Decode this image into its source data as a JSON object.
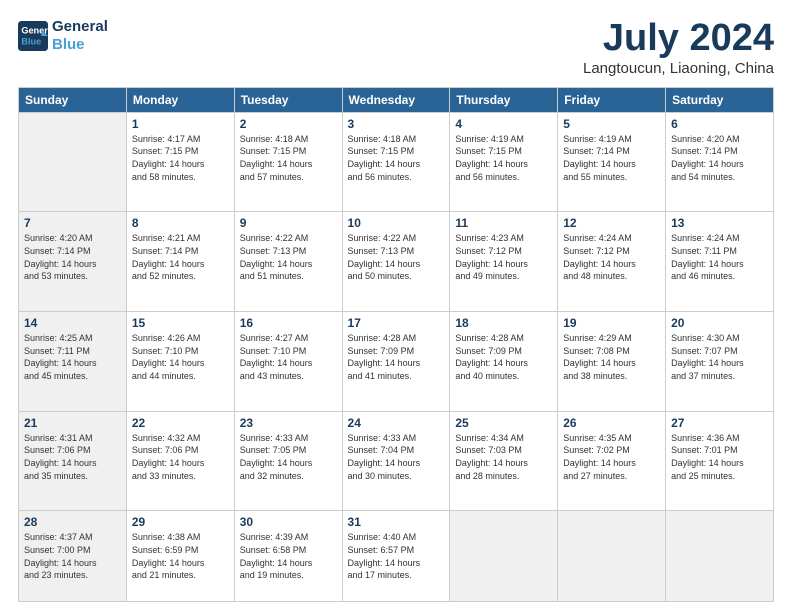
{
  "header": {
    "logo_line1": "General",
    "logo_line2": "Blue",
    "month_year": "July 2024",
    "location": "Langtoucun, Liaoning, China"
  },
  "weekdays": [
    "Sunday",
    "Monday",
    "Tuesday",
    "Wednesday",
    "Thursday",
    "Friday",
    "Saturday"
  ],
  "weeks": [
    [
      {
        "day": "",
        "shaded": true,
        "lines": []
      },
      {
        "day": "1",
        "shaded": false,
        "lines": [
          "Sunrise: 4:17 AM",
          "Sunset: 7:15 PM",
          "Daylight: 14 hours",
          "and 58 minutes."
        ]
      },
      {
        "day": "2",
        "shaded": false,
        "lines": [
          "Sunrise: 4:18 AM",
          "Sunset: 7:15 PM",
          "Daylight: 14 hours",
          "and 57 minutes."
        ]
      },
      {
        "day": "3",
        "shaded": false,
        "lines": [
          "Sunrise: 4:18 AM",
          "Sunset: 7:15 PM",
          "Daylight: 14 hours",
          "and 56 minutes."
        ]
      },
      {
        "day": "4",
        "shaded": false,
        "lines": [
          "Sunrise: 4:19 AM",
          "Sunset: 7:15 PM",
          "Daylight: 14 hours",
          "and 56 minutes."
        ]
      },
      {
        "day": "5",
        "shaded": false,
        "lines": [
          "Sunrise: 4:19 AM",
          "Sunset: 7:14 PM",
          "Daylight: 14 hours",
          "and 55 minutes."
        ]
      },
      {
        "day": "6",
        "shaded": false,
        "lines": [
          "Sunrise: 4:20 AM",
          "Sunset: 7:14 PM",
          "Daylight: 14 hours",
          "and 54 minutes."
        ]
      }
    ],
    [
      {
        "day": "7",
        "shaded": true,
        "lines": [
          "Sunrise: 4:20 AM",
          "Sunset: 7:14 PM",
          "Daylight: 14 hours",
          "and 53 minutes."
        ]
      },
      {
        "day": "8",
        "shaded": false,
        "lines": [
          "Sunrise: 4:21 AM",
          "Sunset: 7:14 PM",
          "Daylight: 14 hours",
          "and 52 minutes."
        ]
      },
      {
        "day": "9",
        "shaded": false,
        "lines": [
          "Sunrise: 4:22 AM",
          "Sunset: 7:13 PM",
          "Daylight: 14 hours",
          "and 51 minutes."
        ]
      },
      {
        "day": "10",
        "shaded": false,
        "lines": [
          "Sunrise: 4:22 AM",
          "Sunset: 7:13 PM",
          "Daylight: 14 hours",
          "and 50 minutes."
        ]
      },
      {
        "day": "11",
        "shaded": false,
        "lines": [
          "Sunrise: 4:23 AM",
          "Sunset: 7:12 PM",
          "Daylight: 14 hours",
          "and 49 minutes."
        ]
      },
      {
        "day": "12",
        "shaded": false,
        "lines": [
          "Sunrise: 4:24 AM",
          "Sunset: 7:12 PM",
          "Daylight: 14 hours",
          "and 48 minutes."
        ]
      },
      {
        "day": "13",
        "shaded": false,
        "lines": [
          "Sunrise: 4:24 AM",
          "Sunset: 7:11 PM",
          "Daylight: 14 hours",
          "and 46 minutes."
        ]
      }
    ],
    [
      {
        "day": "14",
        "shaded": true,
        "lines": [
          "Sunrise: 4:25 AM",
          "Sunset: 7:11 PM",
          "Daylight: 14 hours",
          "and 45 minutes."
        ]
      },
      {
        "day": "15",
        "shaded": false,
        "lines": [
          "Sunrise: 4:26 AM",
          "Sunset: 7:10 PM",
          "Daylight: 14 hours",
          "and 44 minutes."
        ]
      },
      {
        "day": "16",
        "shaded": false,
        "lines": [
          "Sunrise: 4:27 AM",
          "Sunset: 7:10 PM",
          "Daylight: 14 hours",
          "and 43 minutes."
        ]
      },
      {
        "day": "17",
        "shaded": false,
        "lines": [
          "Sunrise: 4:28 AM",
          "Sunset: 7:09 PM",
          "Daylight: 14 hours",
          "and 41 minutes."
        ]
      },
      {
        "day": "18",
        "shaded": false,
        "lines": [
          "Sunrise: 4:28 AM",
          "Sunset: 7:09 PM",
          "Daylight: 14 hours",
          "and 40 minutes."
        ]
      },
      {
        "day": "19",
        "shaded": false,
        "lines": [
          "Sunrise: 4:29 AM",
          "Sunset: 7:08 PM",
          "Daylight: 14 hours",
          "and 38 minutes."
        ]
      },
      {
        "day": "20",
        "shaded": false,
        "lines": [
          "Sunrise: 4:30 AM",
          "Sunset: 7:07 PM",
          "Daylight: 14 hours",
          "and 37 minutes."
        ]
      }
    ],
    [
      {
        "day": "21",
        "shaded": true,
        "lines": [
          "Sunrise: 4:31 AM",
          "Sunset: 7:06 PM",
          "Daylight: 14 hours",
          "and 35 minutes."
        ]
      },
      {
        "day": "22",
        "shaded": false,
        "lines": [
          "Sunrise: 4:32 AM",
          "Sunset: 7:06 PM",
          "Daylight: 14 hours",
          "and 33 minutes."
        ]
      },
      {
        "day": "23",
        "shaded": false,
        "lines": [
          "Sunrise: 4:33 AM",
          "Sunset: 7:05 PM",
          "Daylight: 14 hours",
          "and 32 minutes."
        ]
      },
      {
        "day": "24",
        "shaded": false,
        "lines": [
          "Sunrise: 4:33 AM",
          "Sunset: 7:04 PM",
          "Daylight: 14 hours",
          "and 30 minutes."
        ]
      },
      {
        "day": "25",
        "shaded": false,
        "lines": [
          "Sunrise: 4:34 AM",
          "Sunset: 7:03 PM",
          "Daylight: 14 hours",
          "and 28 minutes."
        ]
      },
      {
        "day": "26",
        "shaded": false,
        "lines": [
          "Sunrise: 4:35 AM",
          "Sunset: 7:02 PM",
          "Daylight: 14 hours",
          "and 27 minutes."
        ]
      },
      {
        "day": "27",
        "shaded": false,
        "lines": [
          "Sunrise: 4:36 AM",
          "Sunset: 7:01 PM",
          "Daylight: 14 hours",
          "and 25 minutes."
        ]
      }
    ],
    [
      {
        "day": "28",
        "shaded": true,
        "lines": [
          "Sunrise: 4:37 AM",
          "Sunset: 7:00 PM",
          "Daylight: 14 hours",
          "and 23 minutes."
        ]
      },
      {
        "day": "29",
        "shaded": false,
        "lines": [
          "Sunrise: 4:38 AM",
          "Sunset: 6:59 PM",
          "Daylight: 14 hours",
          "and 21 minutes."
        ]
      },
      {
        "day": "30",
        "shaded": false,
        "lines": [
          "Sunrise: 4:39 AM",
          "Sunset: 6:58 PM",
          "Daylight: 14 hours",
          "and 19 minutes."
        ]
      },
      {
        "day": "31",
        "shaded": false,
        "lines": [
          "Sunrise: 4:40 AM",
          "Sunset: 6:57 PM",
          "Daylight: 14 hours",
          "and 17 minutes."
        ]
      },
      {
        "day": "",
        "shaded": true,
        "lines": []
      },
      {
        "day": "",
        "shaded": true,
        "lines": []
      },
      {
        "day": "",
        "shaded": true,
        "lines": []
      }
    ]
  ]
}
